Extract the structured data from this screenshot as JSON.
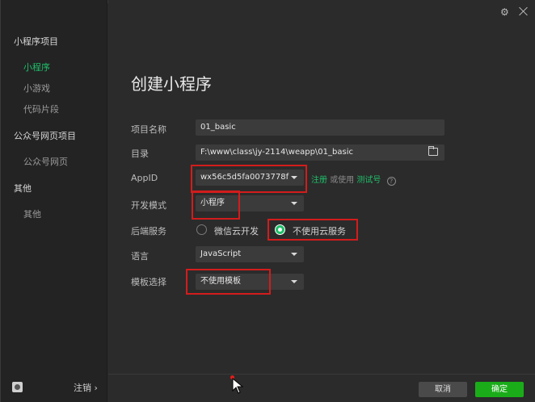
{
  "sidebar": {
    "sections": [
      {
        "label": "小程序项目",
        "items": [
          "小程序",
          "小游戏",
          "代码片段"
        ]
      },
      {
        "label": "公众号网页项目",
        "items": [
          "公众号网页"
        ]
      },
      {
        "label": "其他",
        "items": [
          "其他"
        ]
      }
    ],
    "logout_label": "注销 ›"
  },
  "main": {
    "title": "创建小程序",
    "fields": {
      "project_name_label": "项目名称",
      "project_name_value": "01_basic",
      "dir_label": "目录",
      "dir_value": "F:\\www\\class\\jy-2114\\weapp\\01_basic",
      "appid_label": "AppID",
      "appid_value": "wx56c5d5fa0073778f",
      "register_link": "注册",
      "or_use": "或使用",
      "test_link": "测试号",
      "devmode_label": "开发模式",
      "devmode_value": "小程序",
      "backend_label": "后端服务",
      "backend_option1": "微信云开发",
      "backend_option2": "不使用云服务",
      "lang_label": "语言",
      "lang_value": "JavaScript",
      "template_label": "模板选择",
      "template_value": "不使用模板"
    }
  },
  "footer": {
    "cancel": "取消",
    "ok": "确定"
  },
  "colors": {
    "accent_green": "#1fbf6a",
    "highlight_red": "#d31c1c",
    "ok_button": "#1aad19"
  },
  "icons": {
    "settings": "gear-icon",
    "close": "close-icon",
    "folder": "folder-icon",
    "help": "question-icon"
  }
}
